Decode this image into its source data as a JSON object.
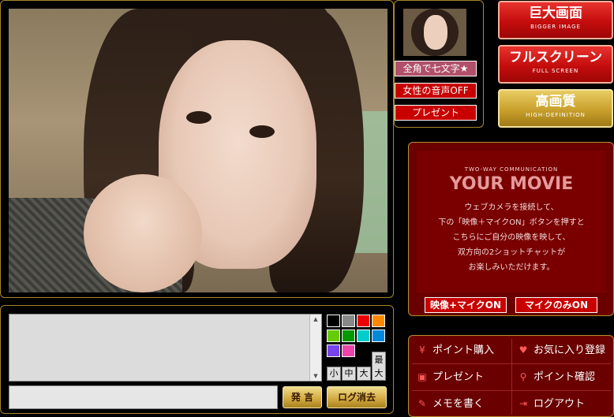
{
  "side_buttons": {
    "chat_mode": "全角で七文字★",
    "voice_off": "女性の音声OFF",
    "present": "プレゼント"
  },
  "view_buttons": {
    "bigger": {
      "title": "巨大画面",
      "sub": "BIGGER IMAGE"
    },
    "fullscreen": {
      "title": "フルスクリーン",
      "sub": "FULL SCREEN"
    },
    "hd": {
      "title": "高画質",
      "sub": "HIGH-DEFINITION"
    }
  },
  "your_movie": {
    "caption": "TWO-WAY COMMUNICATION",
    "title": "YOUR MOVIE",
    "lines": [
      "ウェブカメラを接続して、",
      "下の「映像＋マイクON」ボタンを押すと",
      "こちらにご自分の映像を映して、",
      "双方向の2ショットチャットが",
      "お楽しみいただけます。"
    ],
    "btn_video_mic": "映像+マイクON",
    "btn_mic_only": "マイクのみON"
  },
  "chat": {
    "colors": [
      "#000000",
      "#888888",
      "#ee0000",
      "#ff8800",
      "#66cc00",
      "#009900",
      "#00cccc",
      "#0088dd",
      "#7744ee",
      "#ee44aa"
    ],
    "sizes": [
      "小",
      "中",
      "大",
      "最大"
    ],
    "send": "発 言",
    "clear_log": "ログ消去",
    "message_value": "",
    "log_text": ""
  },
  "menu": {
    "buy_points": {
      "label": "ポイント購入",
      "icon": "yen-icon"
    },
    "favorite": {
      "label": "お気に入り登録",
      "icon": "heart-icon"
    },
    "present": {
      "label": "プレゼント",
      "icon": "gift-icon"
    },
    "check_points": {
      "label": "ポイント確認",
      "icon": "magnifier-icon"
    },
    "write_memo": {
      "label": "メモを書く",
      "icon": "pencil-icon"
    },
    "logout": {
      "label": "ログアウト",
      "icon": "logout-icon"
    }
  }
}
